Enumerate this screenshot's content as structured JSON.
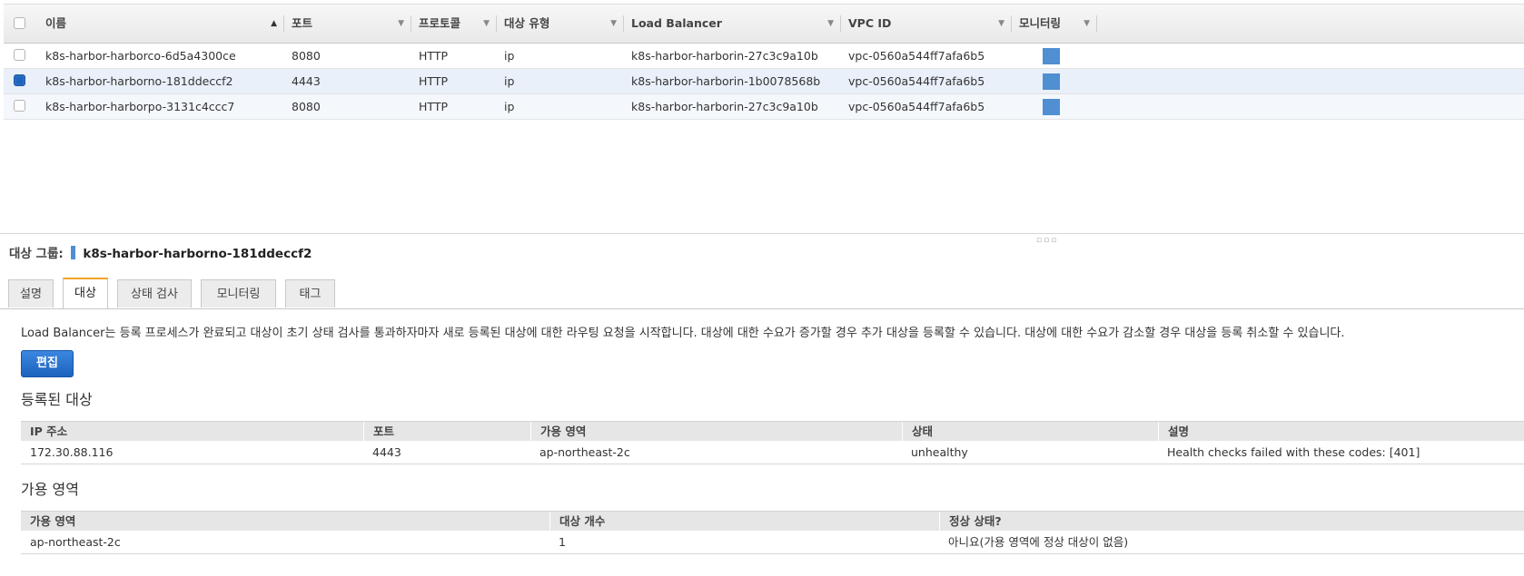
{
  "grid": {
    "columns": [
      {
        "label": "이름",
        "sort": "asc"
      },
      {
        "label": "포트"
      },
      {
        "label": "프로토콜"
      },
      {
        "label": "대상 유형"
      },
      {
        "label": "Load Balancer"
      },
      {
        "label": "VPC ID"
      },
      {
        "label": "모니터링"
      }
    ],
    "rows": [
      {
        "name": "k8s-harbor-harborco-6d5a4300ce",
        "port": "8080",
        "protocol": "HTTP",
        "target_type": "ip",
        "load_balancer": "k8s-harbor-harborin-27c3c9a10b",
        "vpc_id": "vpc-0560a544ff7afa6b5",
        "selected": false
      },
      {
        "name": "k8s-harbor-harborno-181ddeccf2",
        "port": "4443",
        "protocol": "HTTP",
        "target_type": "ip",
        "load_balancer": "k8s-harbor-harborin-1b0078568b",
        "vpc_id": "vpc-0560a544ff7afa6b5",
        "selected": true
      },
      {
        "name": "k8s-harbor-harborpo-3131c4ccc7",
        "port": "8080",
        "protocol": "HTTP",
        "target_type": "ip",
        "load_balancer": "k8s-harbor-harborin-27c3c9a10b",
        "vpc_id": "vpc-0560a544ff7afa6b5",
        "selected": false
      }
    ]
  },
  "detail": {
    "label": "대상 그룹:",
    "name": "k8s-harbor-harborno-181ddeccf2",
    "tabs": [
      "설명",
      "대상",
      "상태 검사",
      "모니터링",
      "태그"
    ],
    "active_tab": "대상",
    "description": "Load Balancer는 등록 프로세스가 완료되고 대상이 초기 상태 검사를 통과하자마자 새로 등록된 대상에 대한 라우팅 요청을 시작합니다. 대상에 대한 수요가 증가할 경우 추가 대상을 등록할 수 있습니다. 대상에 대한 수요가 감소할 경우 대상을 등록 취소할 수 있습니다.",
    "edit_label": "편집",
    "registered": {
      "title": "등록된 대상",
      "headers": [
        "IP 주소",
        "포트",
        "가용 영역",
        "상태",
        "설명"
      ],
      "rows": [
        [
          "172.30.88.116",
          "4443",
          "ap-northeast-2c",
          "unhealthy",
          "Health checks failed with these codes: [401]"
        ]
      ]
    },
    "zones": {
      "title": "가용 영역",
      "headers": [
        "가용 영역",
        "대상 개수",
        "정상 상태?"
      ],
      "rows": [
        [
          "ap-northeast-2c",
          "1",
          "아니요(가용 영역에 정상 대상이 없음)"
        ]
      ]
    }
  },
  "colors": {
    "accent": "#1c63be",
    "monitor": "#4f8fd2",
    "tab_active": "#f0a22a"
  }
}
